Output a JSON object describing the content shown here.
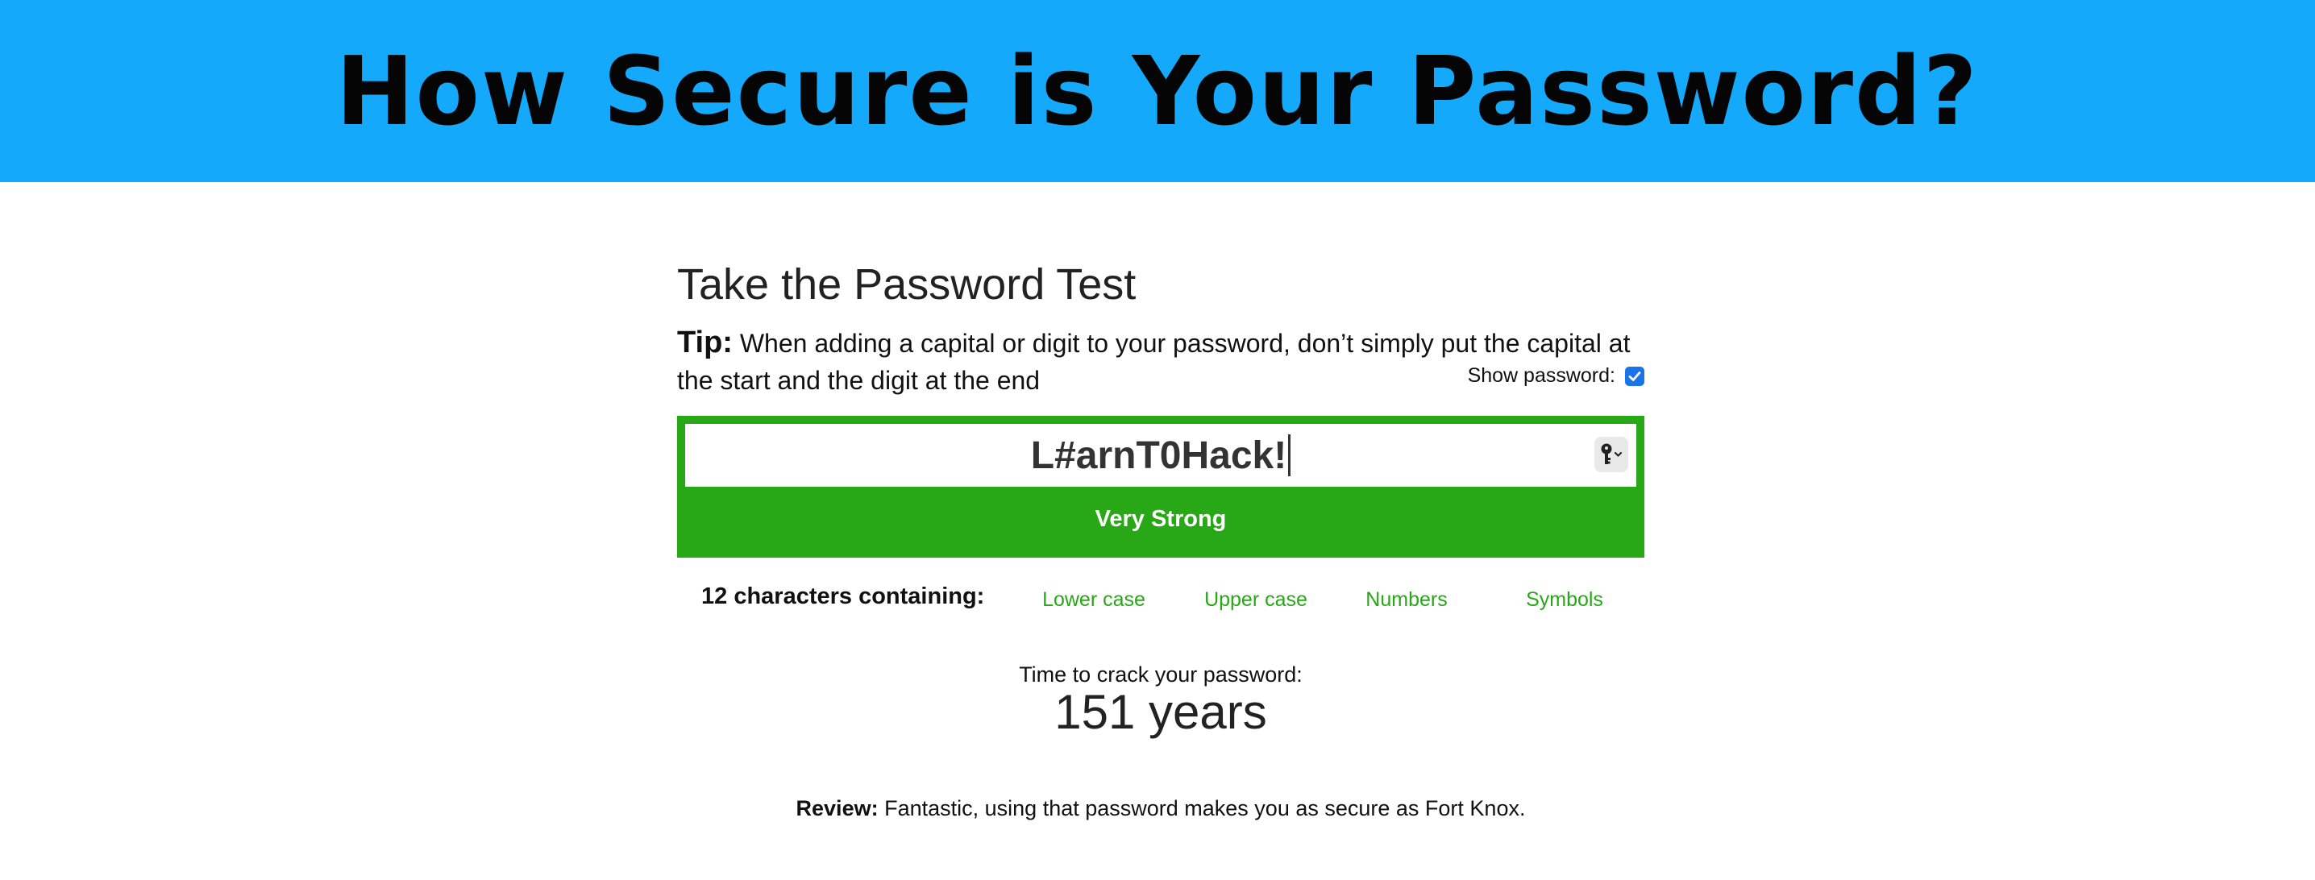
{
  "header": {
    "title": "How Secure is Your Password?"
  },
  "test": {
    "title": "Take the Password Test",
    "tip_label": "Tip:",
    "tip_text": "When adding a capital or digit to your password, don’t simply put the capital at the start and the digit at the end",
    "show_password_label": "Show password:",
    "show_password_checked": true
  },
  "password": {
    "value": "L#arnT0Hack!",
    "strength": "Very Strong",
    "strength_color": "#28a717"
  },
  "criteria": {
    "count_label": "12 characters containing:",
    "items": [
      "Lower case",
      "Upper case",
      "Numbers",
      "Symbols"
    ],
    "met_color": "#28a717"
  },
  "crack": {
    "label": "Time to crack your password:",
    "value": "151 years"
  },
  "review": {
    "label": "Review:",
    "text": "Fantastic, using that password makes you as secure as Fort Knox."
  },
  "colors": {
    "banner": "#15a9fc",
    "checkbox": "#1a73e8"
  },
  "icons": {
    "password_manager": "key-icon",
    "checkbox_check": "check-icon"
  }
}
